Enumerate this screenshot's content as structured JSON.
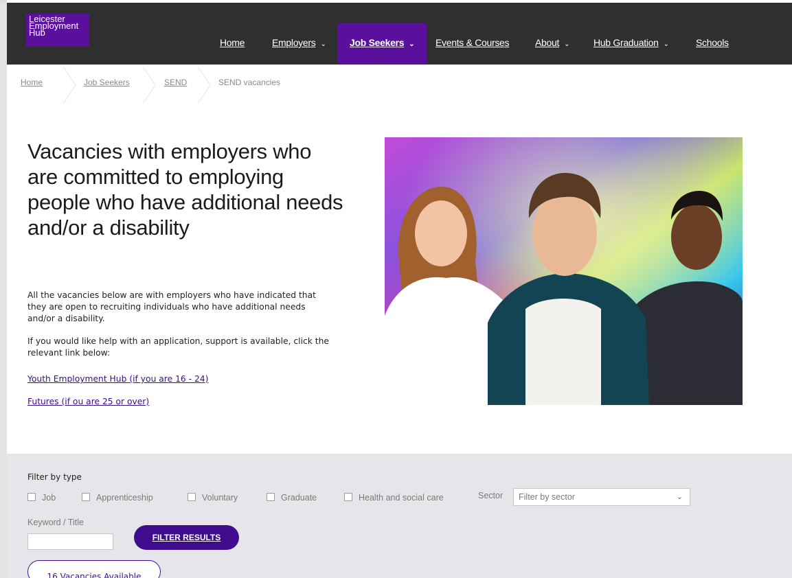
{
  "logo": {
    "line1": "Leicester",
    "line2": "Employment",
    "line3": "Hub"
  },
  "nav": {
    "home": "Home",
    "employers": "Employers",
    "job_seekers": "Job Seekers",
    "events": "Events & Courses",
    "about": "About",
    "hub_graduation": "Hub Graduation",
    "schools": "Schools",
    "dropdown_icon": "chevron-down-icon"
  },
  "breadcrumb": {
    "home": "Home",
    "job_seekers": "Job Seekers",
    "send": "SEND",
    "current": "SEND vacancies"
  },
  "hero": {
    "title": "Vacancies with employers who are committed to employing people who have additional needs and/or a disability",
    "p1": "All the vacancies below are with employers who have indicated that they are open to recruiting individuals who have additional needs and/or a disability.",
    "p2": "If you would like help with an application, support is available, click the relevant link below:",
    "link1": "Youth Employment Hub (if you are 16 - 24)",
    "link2": "Futures (if ou are 25 or over)"
  },
  "filter": {
    "title": "Filter by type",
    "types": [
      "Job",
      "Apprenticeship",
      "Voluntary",
      "Graduate",
      "Health and social care"
    ],
    "sector_label": "Sector",
    "sector_placeholder": "Filter by sector",
    "keyword_label": "Keyword / Title",
    "keyword_value": "",
    "button": "FILTER RESULTS",
    "vacancies": "16 Vacancies Available"
  },
  "colors": {
    "brand_purple": "#5a0f9d",
    "button_purple": "#3e0c8c",
    "nav_bg": "#2f2f2f"
  }
}
